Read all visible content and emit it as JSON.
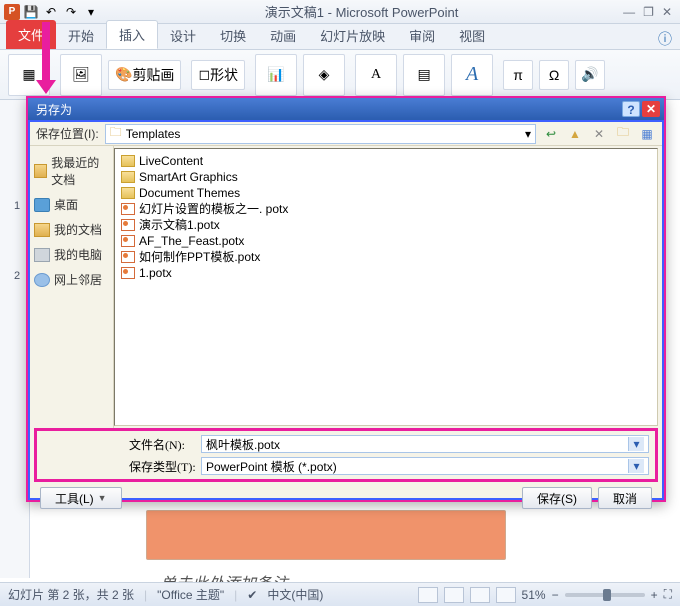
{
  "titlebar": {
    "app_icon_letter": "P",
    "title": "演示文稿1 - Microsoft PowerPoint",
    "min": "—",
    "restore": "❐",
    "close": "✕"
  },
  "ribbon": {
    "tabs": {
      "file": "文件",
      "home": "开始",
      "insert": "插入",
      "design": "设计",
      "transitions": "切换",
      "animations": "动画",
      "slideshow": "幻灯片放映",
      "review": "审阅",
      "view": "视图"
    },
    "clipboard_label": "剪贴画",
    "shapes_label": "形状"
  },
  "thumbs": {
    "n1": "1",
    "n2": "2"
  },
  "dialog": {
    "title": "另存为",
    "loc_label": "保存位置(I):",
    "loc_value": "Templates",
    "places": {
      "recent": "我最近的文档",
      "desktop": "桌面",
      "mydocs": "我的文档",
      "computer": "我的电脑",
      "network": "网上邻居"
    },
    "files": [
      {
        "type": "folder",
        "name": "LiveContent"
      },
      {
        "type": "folder",
        "name": "SmartArt Graphics"
      },
      {
        "type": "folder",
        "name": "Document Themes"
      },
      {
        "type": "potx",
        "name": "幻灯片设置的模板之一. potx"
      },
      {
        "type": "potx",
        "name": "演示文稿1.potx"
      },
      {
        "type": "potx",
        "name": "AF_The_Feast.potx"
      },
      {
        "type": "potx",
        "name": "如何制作PPT模板.potx"
      },
      {
        "type": "potx",
        "name": "1.potx"
      }
    ],
    "filename_label": "文件名(N):",
    "filename_value": "枫叶模板.potx",
    "filetype_label": "保存类型(T):",
    "filetype_value": "PowerPoint 模板 (*.potx)",
    "tools_btn": "工具(L)",
    "save_btn": "保存(S)",
    "cancel_btn": "取消"
  },
  "statusbar": {
    "slide_info": "幻灯片 第 2 张，共 2 张",
    "theme": "\"Office 主题\"",
    "lang": "中文(中国)",
    "zoom": "51%"
  },
  "slide_placeholder": "单击此处添加备注"
}
